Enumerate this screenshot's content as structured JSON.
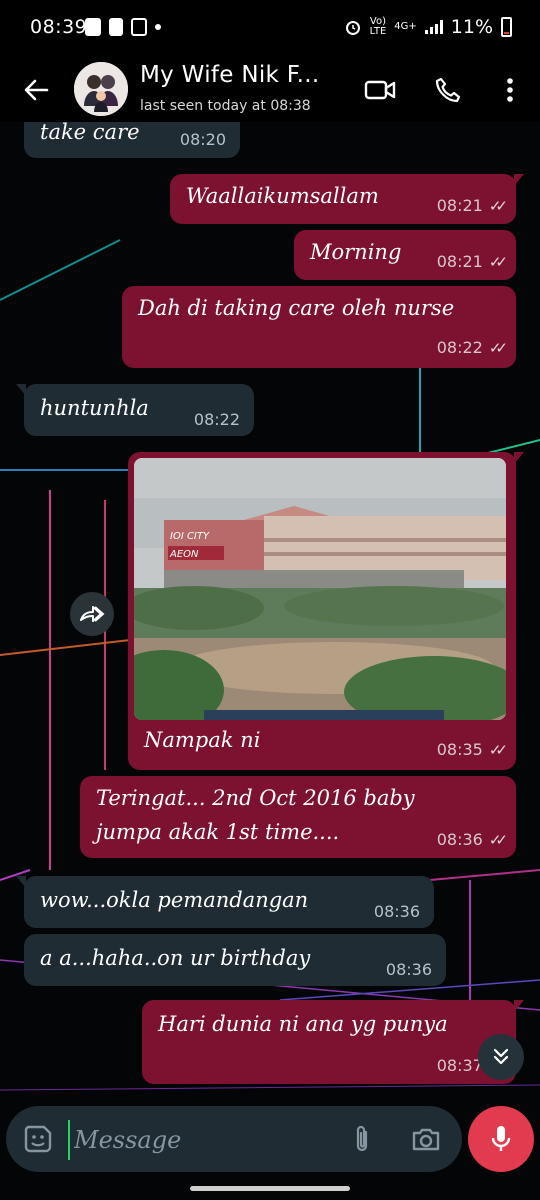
{
  "status_bar": {
    "time": "08:39",
    "network_top": "Vo)",
    "network_bottom": "LTE",
    "data_type": "4G+",
    "battery": "11%"
  },
  "header": {
    "contact_name": "My Wife Nik F...",
    "last_seen": "last seen today at 08:38",
    "icons": [
      "back-arrow-icon",
      "video-call-icon",
      "phone-icon",
      "more-options-icon"
    ]
  },
  "messages": [
    {
      "dir": "in",
      "text": "take care",
      "time": "08:20"
    },
    {
      "dir": "out",
      "text": "Waallaikumsallam",
      "time": "08:21",
      "ticks": "✓✓"
    },
    {
      "dir": "out",
      "text": "Morning",
      "time": "08:21",
      "ticks": "✓✓"
    },
    {
      "dir": "out",
      "text": "Dah di taking care oleh nurse",
      "time": "08:22",
      "ticks": "✓✓"
    },
    {
      "dir": "in",
      "text": "huntunhla",
      "time": "08:22"
    },
    {
      "dir": "out",
      "type": "image",
      "caption": "Nampak ni",
      "time": "08:35",
      "ticks": "✓✓",
      "photo_signs": [
        "IOI CITY",
        "AEON"
      ]
    },
    {
      "dir": "out",
      "line1": "Teringat... 2nd Oct 2016 baby",
      "line2": "jumpa akak 1st time....",
      "time": "08:36",
      "ticks": "✓✓"
    },
    {
      "dir": "in",
      "text": "wow...okla pemandangan",
      "time": "08:36"
    },
    {
      "dir": "in",
      "text": "a a...haha..on ur birthday",
      "time": "08:36"
    },
    {
      "dir": "out",
      "text": "Hari dunia ni ana yg punya",
      "time": "08:37",
      "ticks": "✓✓"
    }
  ],
  "composer": {
    "placeholder": "Message"
  },
  "colors": {
    "outgoing_bubble": "#7c1130",
    "incoming_bubble": "#1f2c34",
    "mic_button": "#e23b4f",
    "cursor": "#25d366"
  }
}
